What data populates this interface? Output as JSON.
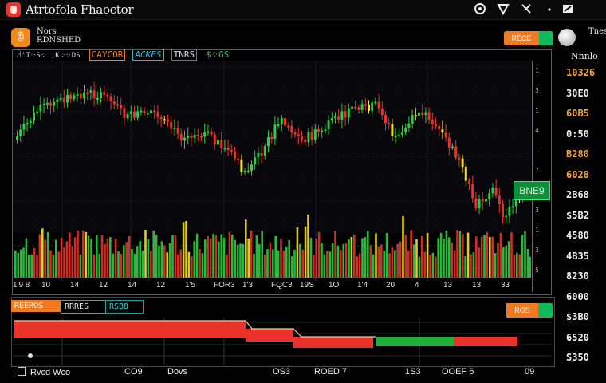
{
  "app": {
    "title": "Atrtofola Fhaoctor"
  },
  "top_icons": [
    "chrome-icon",
    "shield-icon",
    "tools-icon",
    "dot-menu-icon",
    "edit-icon"
  ],
  "symbol": {
    "logo_glyph": "ꂦ",
    "name": "Nors",
    "sub": "RDNSHED"
  },
  "chart_toolbar": [
    "ꃄ'T⁘S⁘ ,K⁘⁘DS",
    "CAYCOR",
    "ACKES",
    "TNRS",
    "$⁘GS"
  ],
  "right_controls": {
    "toggle_label": "RECE",
    "title": "Tnes",
    "subtitle": "Nnnlo"
  },
  "price_axis": [
    "1",
    "3",
    "1",
    "4",
    "1",
    "7",
    "1",
    "3",
    "1",
    "3",
    "5"
  ],
  "last_price": "BNE9",
  "time_axis": [
    "1'9 8",
    "10",
    "14",
    "12",
    "14",
    "12",
    "1'5",
    "FOR3",
    "1'3",
    "FQC3",
    "19S",
    "1O",
    "1'4",
    "20",
    "4",
    "13",
    "13",
    "33"
  ],
  "side_list": [
    {
      "text": "10326",
      "color": "#f2a33a"
    },
    {
      "text": "30E0",
      "color": "#eeeeee"
    },
    {
      "text": "60B5",
      "color": "#f2a33a"
    },
    {
      "text": "0:50",
      "color": "#eeeeee"
    },
    {
      "text": "B280",
      "color": "#f2a33a"
    },
    {
      "text": "6028",
      "color": "#f2a33a"
    },
    {
      "text": "2B68",
      "color": "#eeeeee"
    },
    {
      "text": "$5B2",
      "color": "#eeeeee"
    },
    {
      "text": "4580",
      "color": "#eeeeee"
    },
    {
      "text": "4B35",
      "color": "#eeeeee"
    },
    {
      "text": "8230",
      "color": "#eeeeee"
    },
    {
      "text": "6000",
      "color": "#eeeeee"
    },
    {
      "text": "$3B0",
      "color": "#eeeeee"
    },
    {
      "text": "6520",
      "color": "#eeeeee"
    },
    {
      "text": "S350",
      "color": "#eeeeee"
    }
  ],
  "lower_panel": {
    "tabs": [
      "REEROS",
      "RRRES",
      "RSB8"
    ],
    "toggle_label": "RGS"
  },
  "bottom_row": [
    "Rvcd Wco",
    "CO9",
    "Dovs",
    "OS3",
    "ROED 7",
    "1S3",
    "OOEF 6",
    "09"
  ],
  "colors": {
    "up": "#2ecc40",
    "down": "#e8322a",
    "neutral": "#f5e02a",
    "bg": "#000000"
  }
}
